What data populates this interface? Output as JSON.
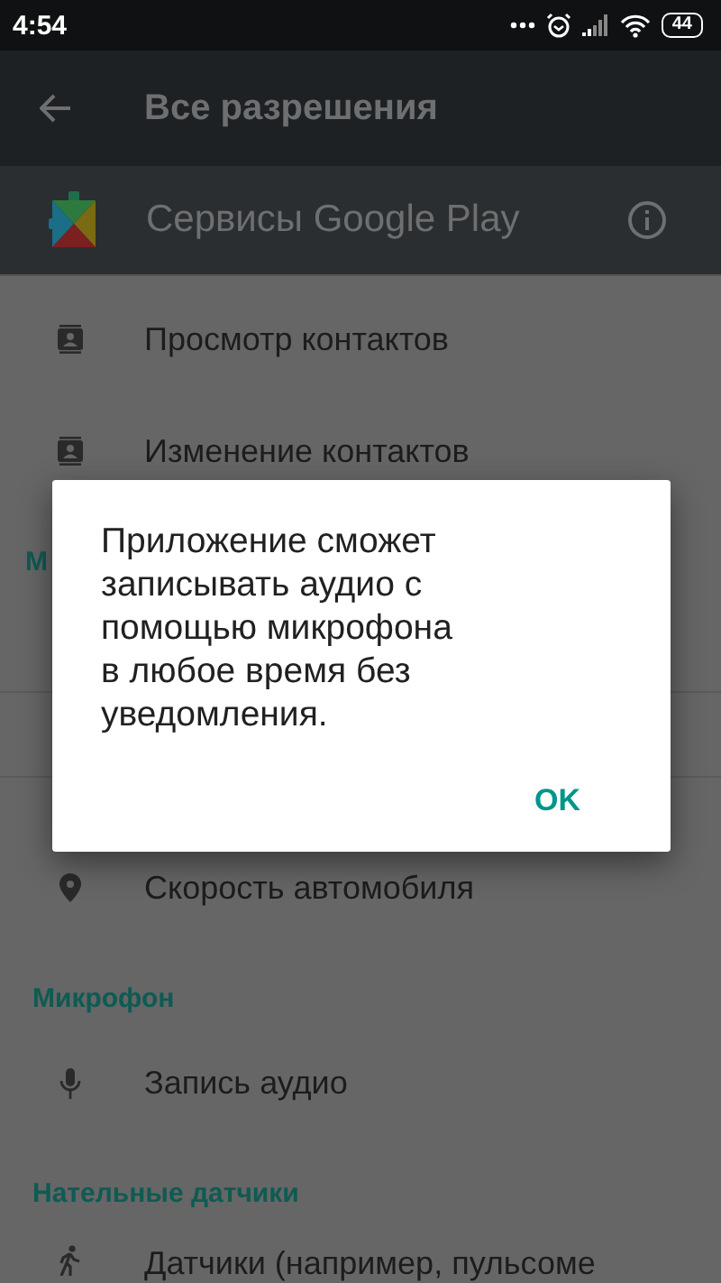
{
  "status_bar": {
    "time": "4:54",
    "battery": "44"
  },
  "toolbar": {
    "title": "Все разрешения"
  },
  "app_header": {
    "name": "Сервисы Google Play"
  },
  "list": [
    {
      "kind": "contacts",
      "label": "Просмотр контактов"
    },
    {
      "kind": "contacts",
      "label": "Изменение контактов"
    },
    {
      "kind": "header",
      "label": "М"
    },
    {
      "kind": "gap"
    },
    {
      "kind": "location",
      "label": "Скорость автомобиля"
    },
    {
      "kind": "header",
      "label": "Микрофон"
    },
    {
      "kind": "microphone",
      "label": "Запись аудио"
    },
    {
      "kind": "header",
      "label": "Нательные датчики"
    },
    {
      "kind": "sensor",
      "label": "Датчики (например, пульсоме"
    }
  ],
  "dialog": {
    "message": "Приложение сможет\nзаписывать аудио с\nпомощью микрофона\nв любое время без\nуведомления.",
    "button": "OK"
  }
}
